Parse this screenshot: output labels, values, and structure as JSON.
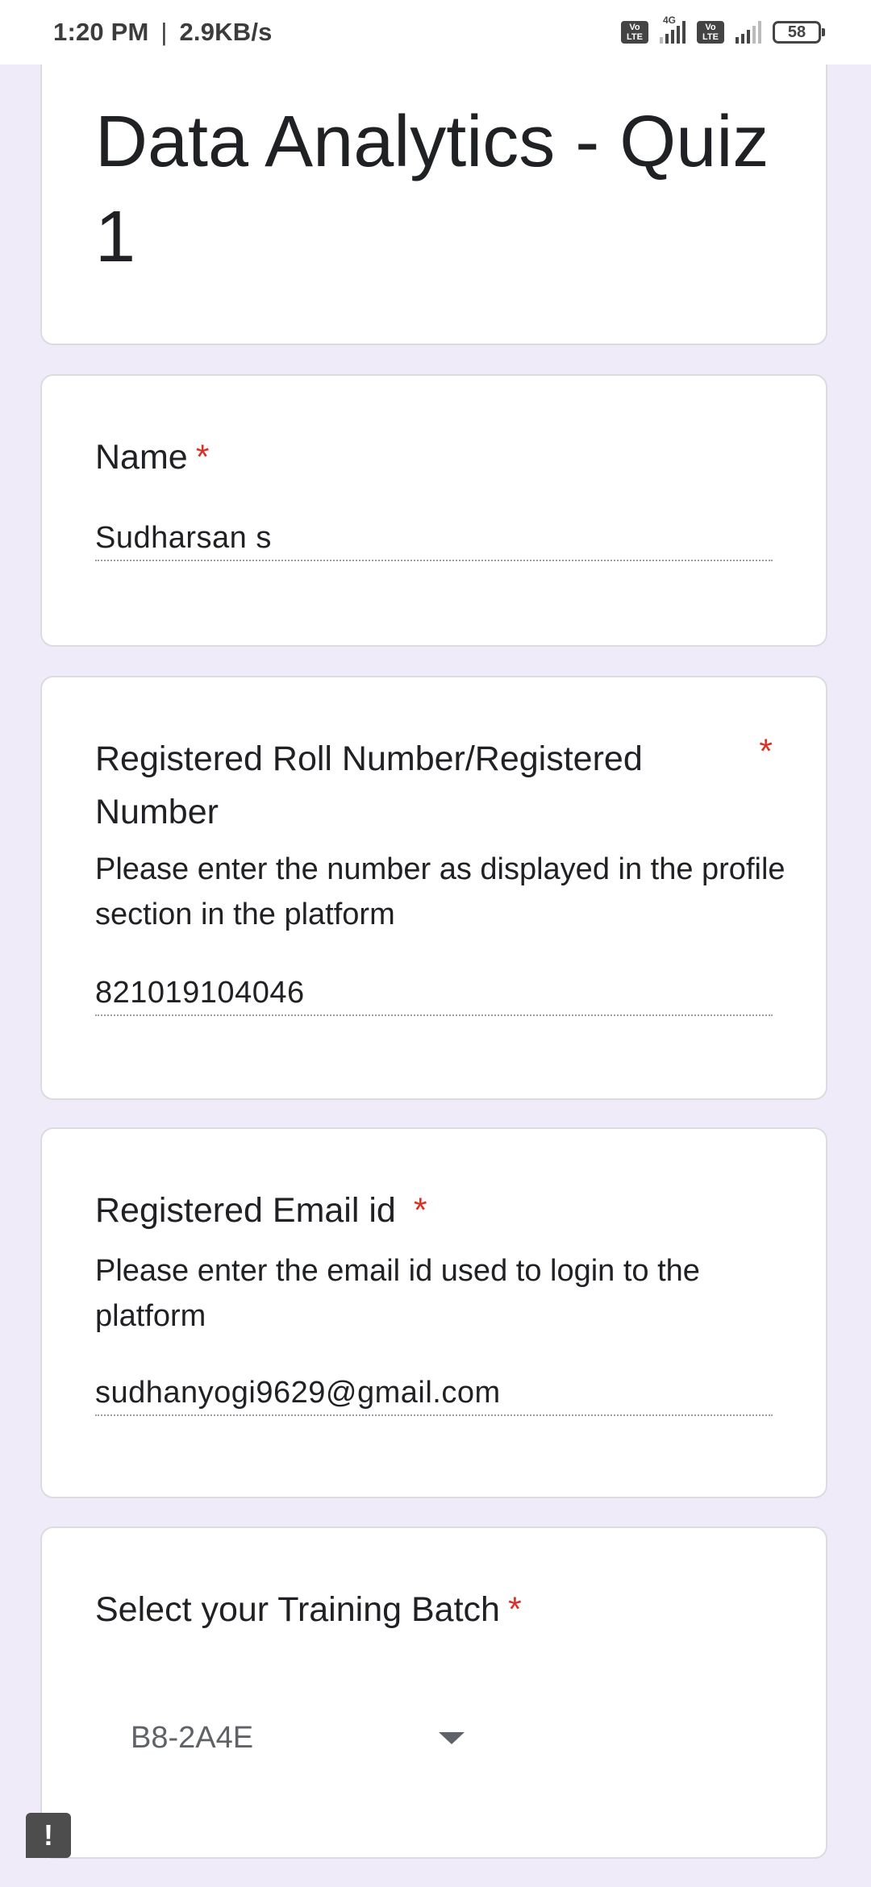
{
  "status_bar": {
    "time": "1:20 PM",
    "separator": "|",
    "network_speed": "2.9KB/s",
    "volte1_line1": "Vo",
    "volte1_line2": "LTE",
    "network_type": "4G",
    "volte2_line1": "Vo",
    "volte2_line2": "LTE",
    "battery": "58"
  },
  "form": {
    "title": "Data Analytics - Quiz 1"
  },
  "questions": [
    {
      "label": "Name",
      "required_mark": "*",
      "answer": "Sudharsan s"
    },
    {
      "label": "Registered Roll Number/Registered Number",
      "required_mark": "*",
      "help": "Please enter the number as displayed in the profile section in the platform",
      "answer": "821019104046"
    },
    {
      "label": "Registered Email id",
      "required_mark": "*",
      "help": "Please enter the email id used to login to the platform",
      "answer": "sudhanyogi9629@gmail.com"
    },
    {
      "label": "Select your Training Batch",
      "required_mark": "*",
      "selected": "B8-2A4E"
    }
  ],
  "feedback": {
    "icon": "!"
  },
  "colors": {
    "background": "#efebf8",
    "required": "#d93025",
    "text": "#202124"
  }
}
